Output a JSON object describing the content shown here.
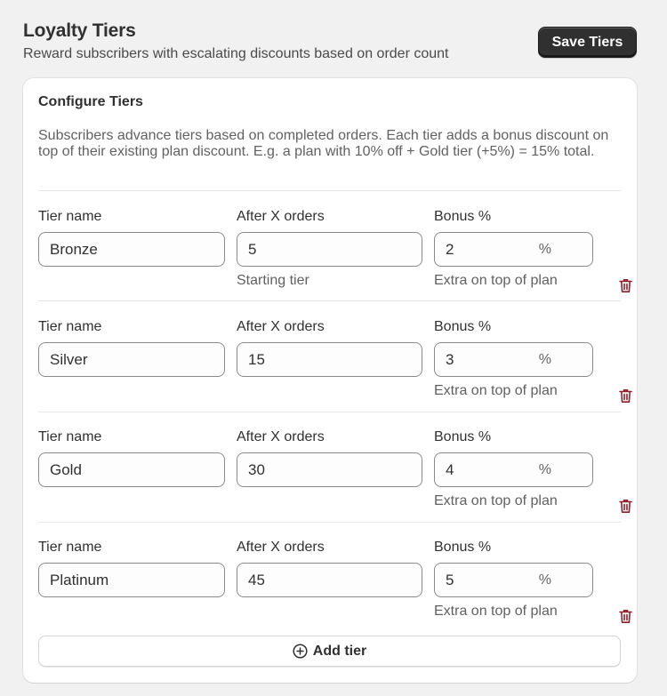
{
  "header": {
    "title": "Loyalty Tiers",
    "subtitle": "Reward subscribers with escalating discounts based on order count",
    "save_label": "Save Tiers"
  },
  "card": {
    "title": "Configure Tiers",
    "description": "Subscribers advance tiers based on completed orders. Each tier adds a bonus discount on top of their existing plan discount. E.g. a plan with 10% off + Gold tier (+5%) = 15% total.",
    "add_label": "Add tier"
  },
  "labels": {
    "tier_name": "Tier name",
    "after_orders": "After X orders",
    "bonus": "Bonus %",
    "suffix": "%"
  },
  "tiers": [
    {
      "name": "Bronze",
      "orders": "5",
      "bonus": "2",
      "orders_help": "Starting tier",
      "bonus_help": "Extra on top of plan"
    },
    {
      "name": "Silver",
      "orders": "15",
      "bonus": "3",
      "orders_help": "",
      "bonus_help": "Extra on top of plan"
    },
    {
      "name": "Gold",
      "orders": "30",
      "bonus": "4",
      "orders_help": "",
      "bonus_help": "Extra on top of plan"
    },
    {
      "name": "Platinum",
      "orders": "45",
      "bonus": "5",
      "orders_help": "",
      "bonus_help": "Extra on top of plan"
    }
  ],
  "colors": {
    "primary_button": "#303030",
    "delete_icon": "#8e1f2b",
    "border": "#8a8a8a"
  },
  "icons": {
    "delete": "trash-icon",
    "add": "plus-circle-icon"
  }
}
